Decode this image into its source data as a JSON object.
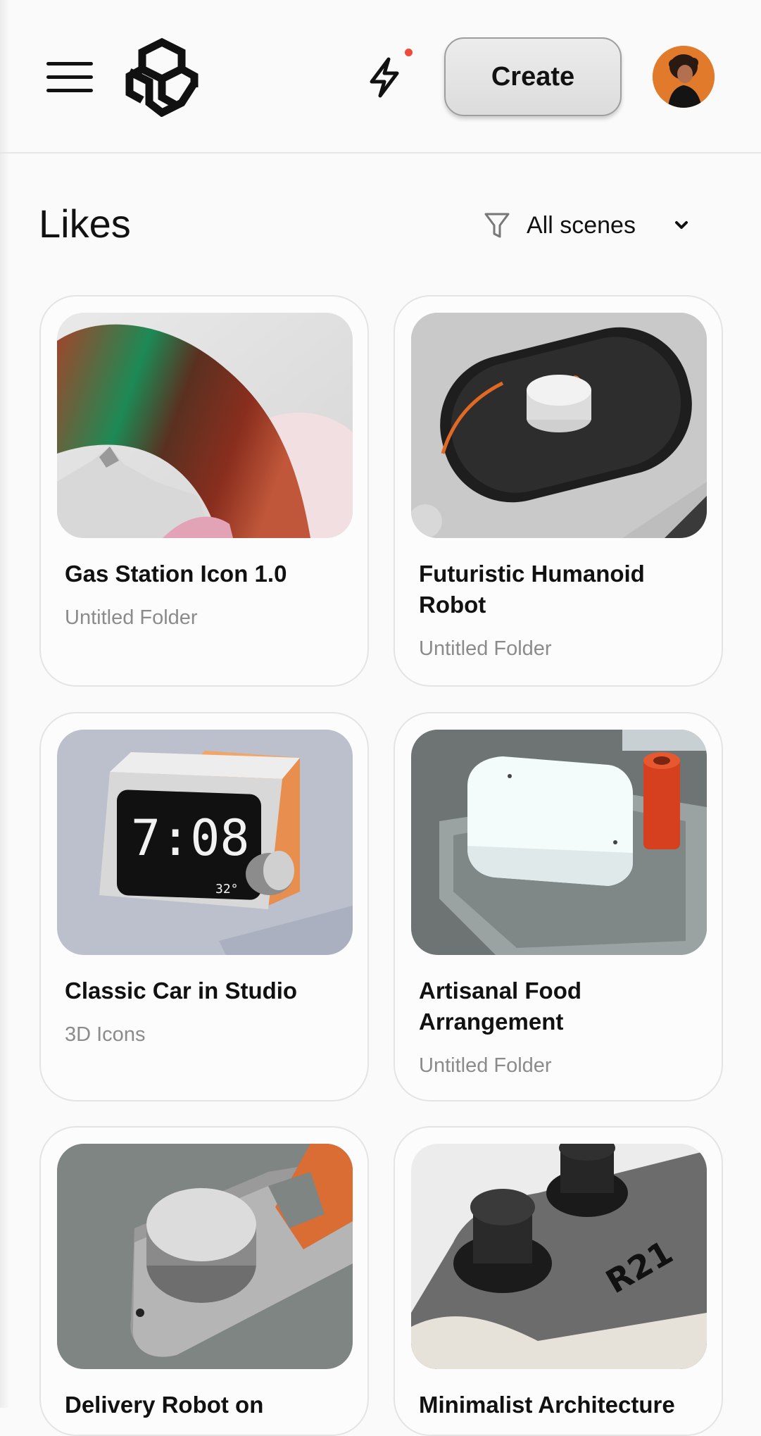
{
  "header": {
    "create_label": "Create"
  },
  "page": {
    "title": "Likes",
    "filter_label": "All scenes"
  },
  "cards": [
    {
      "title": "Gas Station Icon 1.0",
      "folder": "Untitled Folder"
    },
    {
      "title": "Futuristic Humanoid Robot",
      "folder": "Untitled Folder"
    },
    {
      "title": "Classic Car in Studio",
      "folder": "3D Icons"
    },
    {
      "title": "Artisanal Food Arrangement",
      "folder": "Untitled Folder"
    },
    {
      "title": "Delivery Robot on",
      "folder": ""
    },
    {
      "title": "Minimalist Architecture",
      "folder": ""
    }
  ],
  "thumbs": {
    "clock_time": "7:08",
    "clock_temp": "32°",
    "controller_label": "R21"
  },
  "icons": [
    "menu-icon",
    "logo-icon",
    "bolt-icon",
    "filter-funnel-icon",
    "chevron-down-icon"
  ],
  "colors": {
    "accent_orange": "#e27a2c",
    "notification": "#ef4a3c"
  }
}
